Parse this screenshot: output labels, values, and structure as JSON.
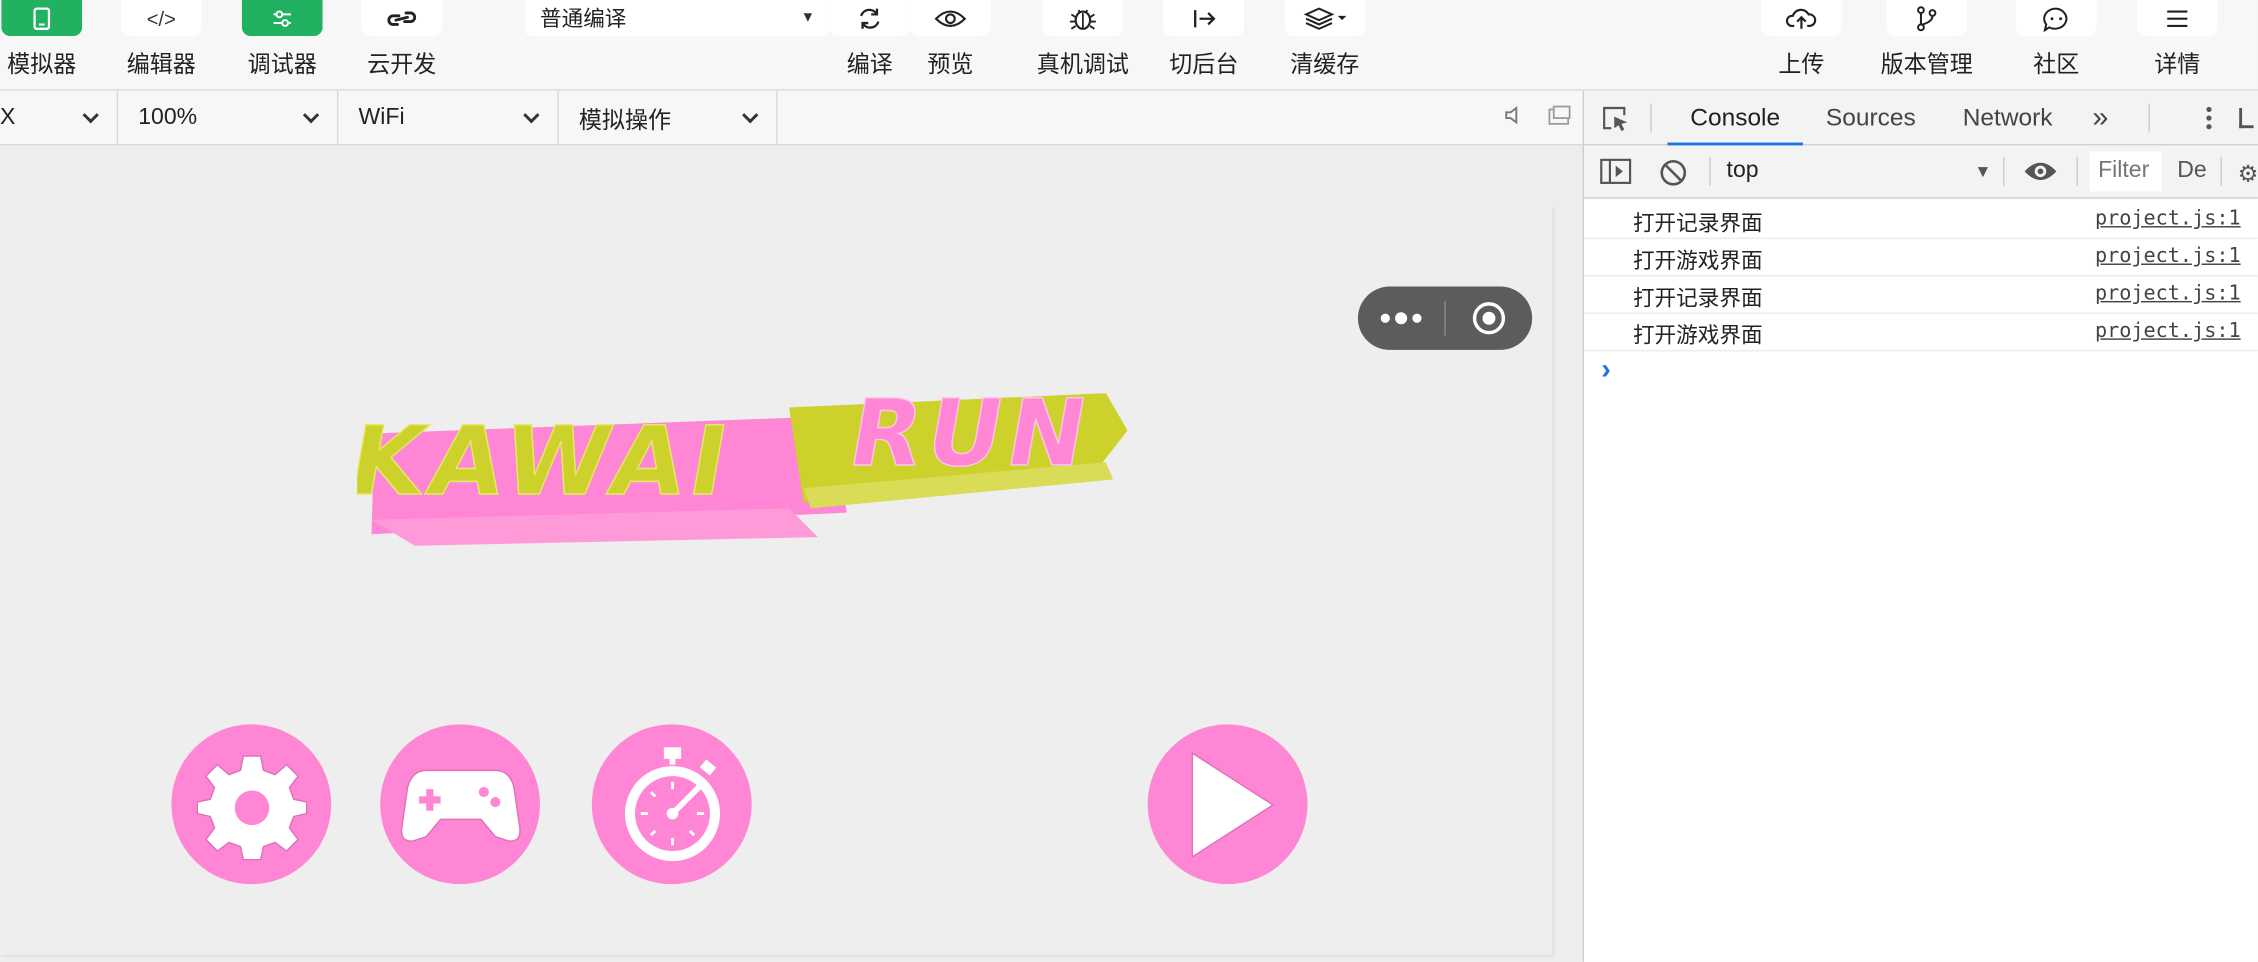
{
  "toolbar": {
    "simulator": "模拟器",
    "editor": "编辑器",
    "debugger": "调试器",
    "cloud": "云开发",
    "compile_mode": "普通编译",
    "compile": "编译",
    "preview": "预览",
    "real_device": "真机调试",
    "background": "切后台",
    "clear_cache": "清缓存",
    "upload": "上传",
    "version": "版本管理",
    "community": "社区",
    "details": "详情"
  },
  "simbar": {
    "device": "X",
    "zoom": "100%",
    "network": "WiFi",
    "operation": "模拟操作"
  },
  "game": {
    "title_part1": "KAWAI",
    "title_part2": "RUN"
  },
  "devtools": {
    "tabs": [
      "Console",
      "Sources",
      "Network"
    ],
    "more": "»",
    "context": "top",
    "filter_placeholder": "Filter",
    "levels": "De",
    "logs": [
      {
        "msg": "打开记录界面",
        "src": "project.js:1"
      },
      {
        "msg": "打开游戏界面",
        "src": "project.js:1"
      },
      {
        "msg": "打开记录界面",
        "src": "project.js:1"
      },
      {
        "msg": "打开游戏界面",
        "src": "project.js:1"
      }
    ],
    "prompt": "›"
  },
  "colors": {
    "accent_green": "#22b061",
    "pink": "#ff86d4",
    "yellow": "#cdd12c",
    "devtools_blue": "#1a73e8"
  }
}
